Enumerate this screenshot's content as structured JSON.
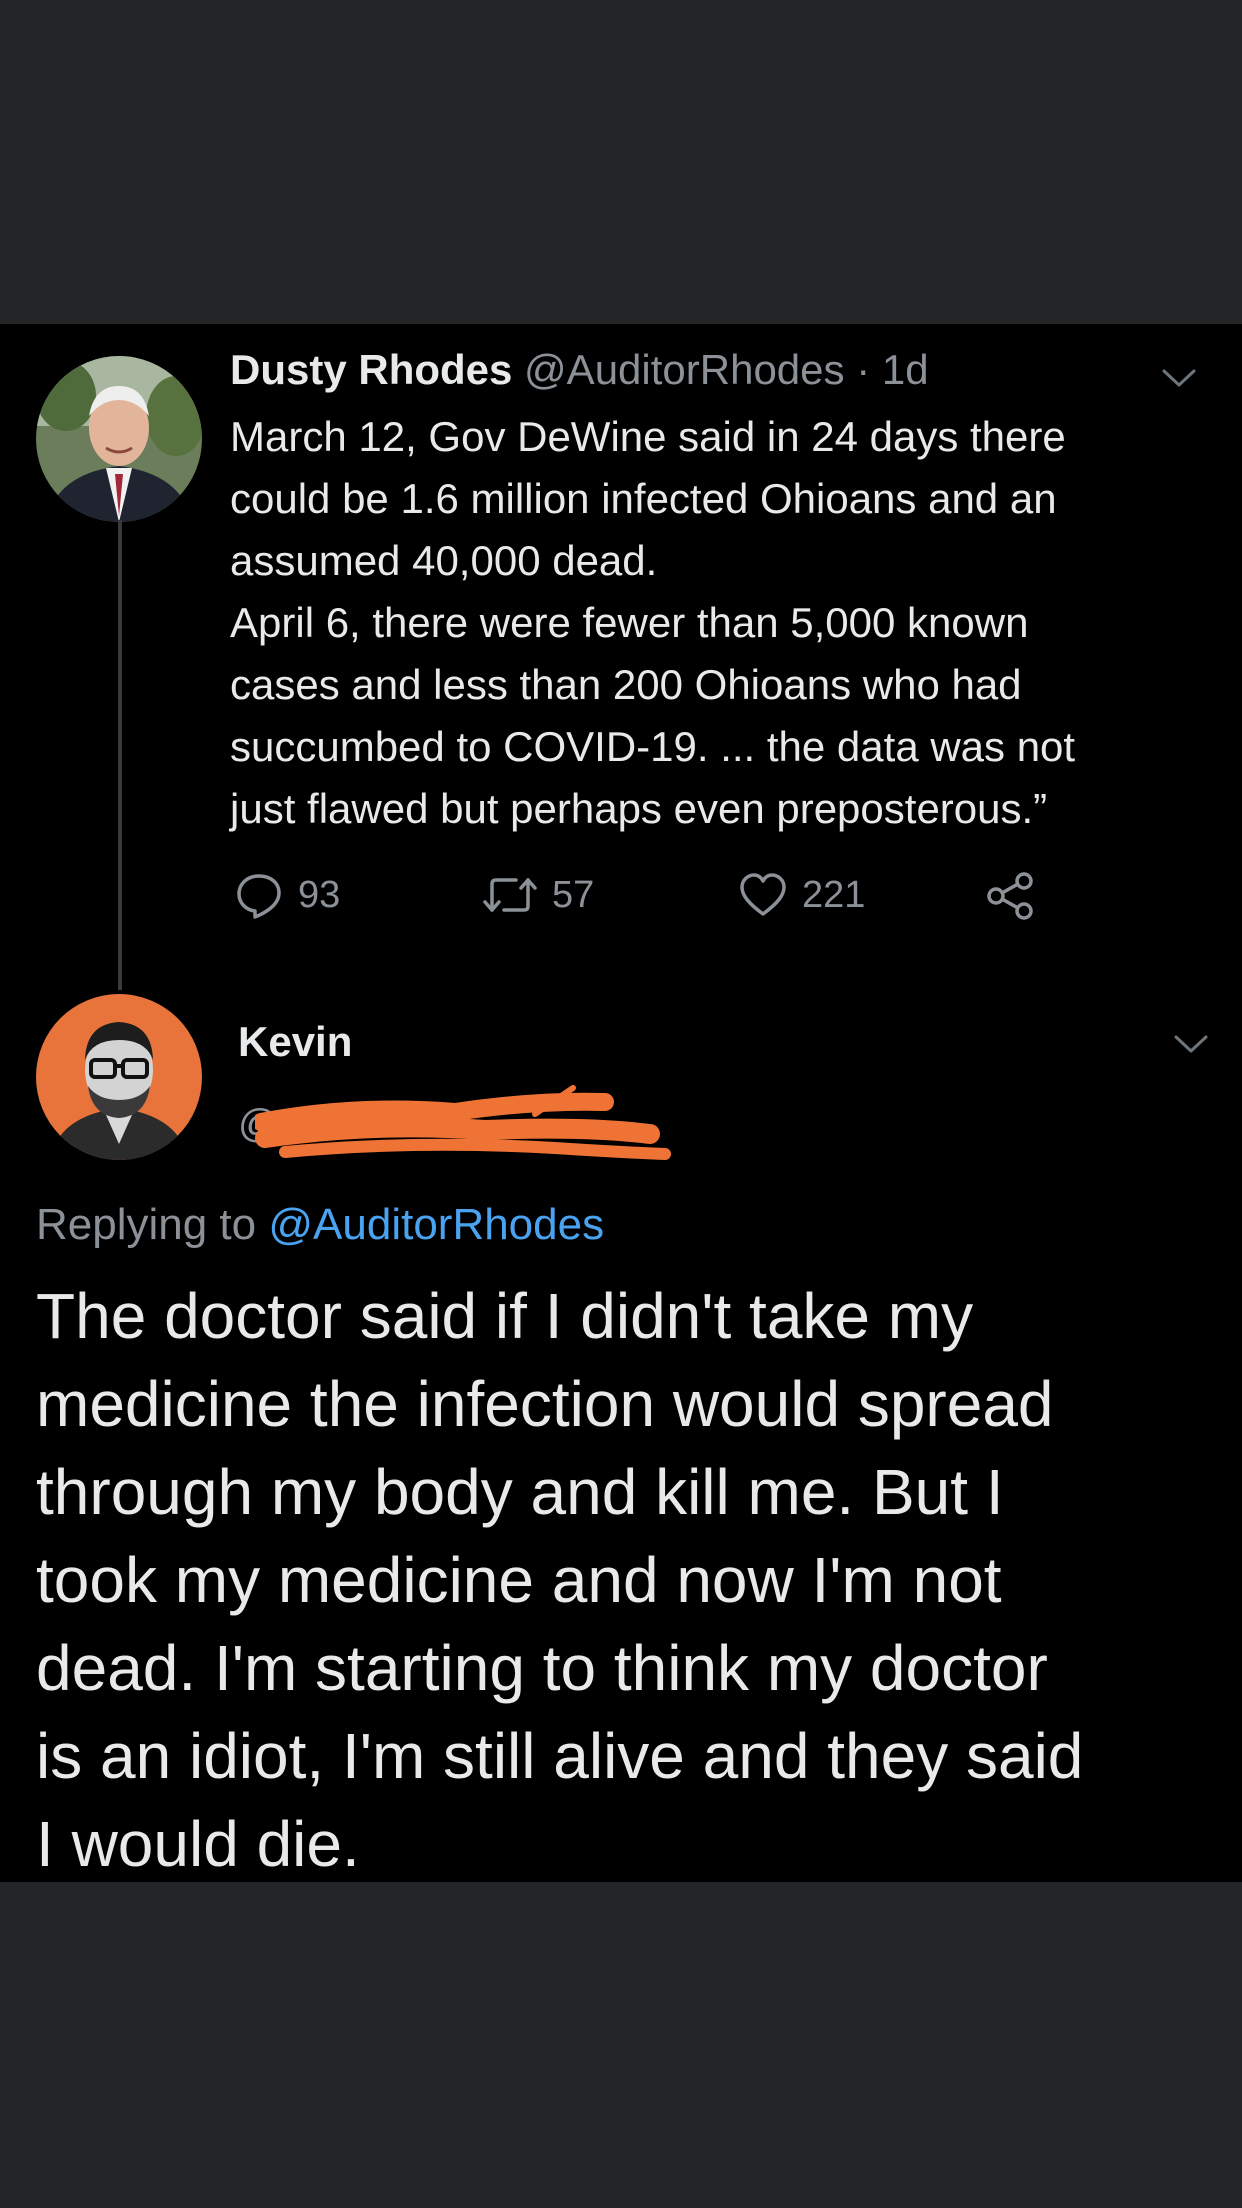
{
  "tweet1": {
    "display_name": "Dusty Rhodes",
    "handle": "@AuditorRhodes",
    "separator": " · ",
    "age": "1d",
    "body_lines": [
      "March 12, Gov DeWine said in 24 days there",
      "could be 1.6 million infected Ohioans and an",
      "assumed 40,000 dead.",
      "April 6, there were fewer than 5,000 known",
      "cases and less than 200 Ohioans who had",
      "succumbed to COVID-19. ... the data was not",
      "just flawed but perhaps even preposterous.”"
    ],
    "replies": "93",
    "retweets": "57",
    "likes": "221"
  },
  "tweet2": {
    "display_name": "Kevin",
    "handle_prefix": "@",
    "replying_prefix": "Replying to ",
    "replying_mention": "@AuditorRhodes",
    "body_lines": [
      "The doctor said if I didn't take my",
      "medicine the infection would spread",
      "through my body and kill me. But I",
      "took my medicine and now I'm not",
      "dead. I'm starting to think my doctor",
      "is an idiot, I'm still alive and they said",
      "I would die."
    ]
  },
  "icons": {
    "reply": "reply-icon",
    "retweet": "retweet-icon",
    "like": "heart-icon",
    "share": "share-icon",
    "more": "chevron-down-icon"
  },
  "colors": {
    "background": "#000000",
    "frame": "#242526",
    "text": "#e7e9ea",
    "secondary": "#8b9197",
    "link": "#4aa3f0",
    "avatar2_bg": "#e8743b",
    "redaction": "#f07336"
  }
}
